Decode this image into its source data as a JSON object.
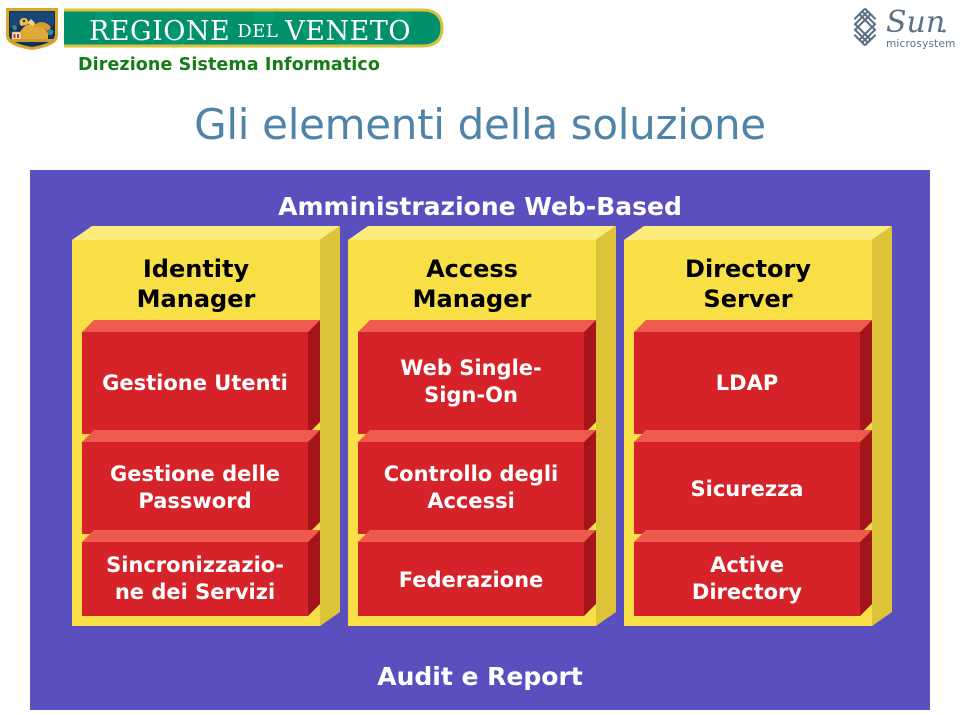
{
  "header": {
    "crest_icon": "veneto-lion-crest-icon",
    "banner_text": "REGIONE DEL VENETO",
    "department": "Direzione Sistema Informatico",
    "sun_logo_icon": "sun-microsystems-logo-icon",
    "sun_wordmark": "Sun",
    "sun_subtext": "microsystems",
    "banner_color": "#00906B",
    "department_color": "#167C17"
  },
  "slide": {
    "title": "Gli elementi della soluzione",
    "title_color": "#4F83A8"
  },
  "diagram": {
    "top_banner": "Amministrazione Web-Based",
    "bottom_banner": "Audit e Report",
    "panel_color": "#5A4FBE",
    "column_color": "#F9DF46",
    "item_color": "#D62229",
    "columns": [
      {
        "title_line1": "Identity",
        "title_line2": "Manager",
        "items": [
          {
            "lines": [
              "Gestione Utenti"
            ]
          },
          {
            "lines": [
              "Gestione delle",
              "Password"
            ]
          },
          {
            "lines": [
              "Sincronizzazio-",
              "ne dei Servizi"
            ]
          }
        ]
      },
      {
        "title_line1": "Access",
        "title_line2": "Manager",
        "items": [
          {
            "lines": [
              "Web Single-",
              "Sign-On"
            ]
          },
          {
            "lines": [
              "Controllo degli",
              "Accessi"
            ]
          },
          {
            "lines": [
              "Federazione"
            ]
          }
        ]
      },
      {
        "title_line1": "Directory",
        "title_line2": "Server",
        "items": [
          {
            "lines": [
              "LDAP"
            ]
          },
          {
            "lines": [
              "Sicurezza"
            ]
          },
          {
            "lines": [
              "Active",
              "Directory"
            ]
          }
        ]
      }
    ]
  }
}
